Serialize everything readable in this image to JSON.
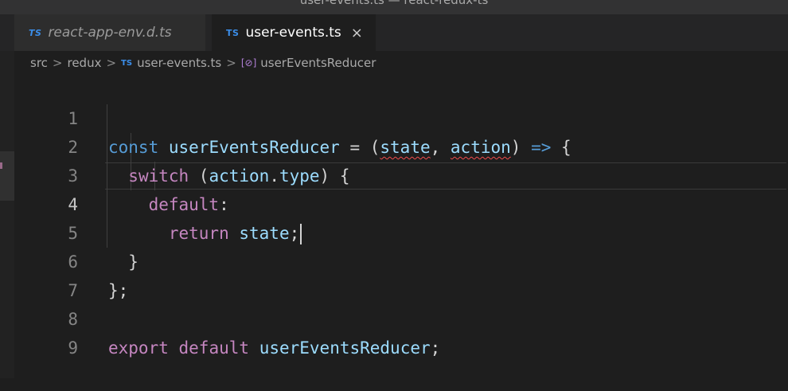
{
  "window": {
    "title": "user-events.ts — react-redux-ts"
  },
  "tabs": [
    {
      "icon": "TS",
      "label": "react-app-env.d.ts"
    },
    {
      "icon": "TS",
      "label": "user-events.ts",
      "close": "×"
    }
  ],
  "breadcrumb": {
    "parts": [
      "src",
      "redux",
      "user-events.ts",
      "userEventsReducer"
    ],
    "file_icon": "TS",
    "sep": ">",
    "symbol_icon": "[⊘]"
  },
  "editor": {
    "line_numbers": [
      "1",
      "2",
      "3",
      "4",
      "5",
      "6",
      "7",
      "8",
      "9"
    ],
    "lines": {
      "l1": {
        "kw": "const",
        "name": "userEventsReducer",
        "eq": " = (",
        "p1": "state",
        "comma": ", ",
        "p2": "action",
        "close": ")",
        "arrow": " => ",
        "brace": "{"
      },
      "l2": {
        "kw": "switch",
        "open": " (",
        "obj": "action",
        "dot": ".",
        "prop": "type",
        "close": ") {"
      },
      "l3": {
        "kw": "default",
        "colon": ":"
      },
      "l4": {
        "kw": "return",
        "sp": " ",
        "val": "state",
        "semi": ";"
      },
      "l5": {
        "text": "}"
      },
      "l6": {
        "text": "};"
      },
      "l8": {
        "kw1": "export",
        "kw2": "default",
        "name": "userEventsReducer",
        "semi": ";"
      }
    }
  }
}
